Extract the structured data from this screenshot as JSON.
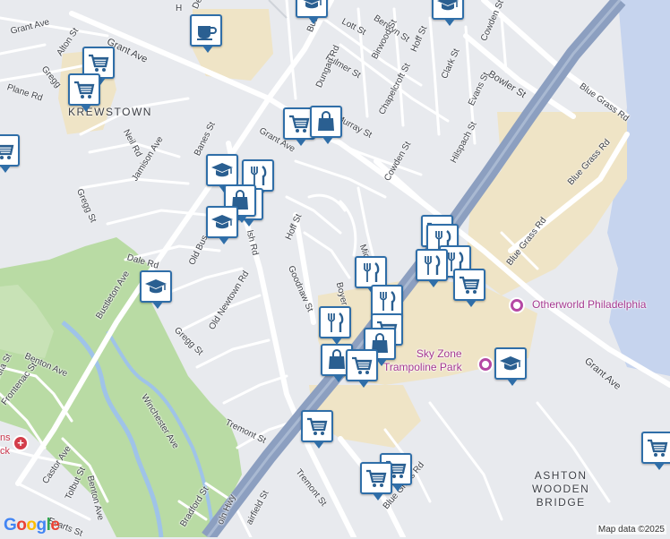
{
  "map": {
    "colors": {
      "background": "#e8eaee",
      "road": "#ffffff",
      "highway": "#8c9fc0",
      "park": "#b9dba4",
      "water": "#c6d4ee",
      "commercial": "#efe4c6",
      "river": "#9fc3e8",
      "pin_border": "#2f6ea8"
    },
    "area_labels": {
      "krewstown": "KREWSTOWN",
      "ashton_l1": "ASHTON",
      "ashton_l2": "WOODEN",
      "ashton_l3": "BRIDGE"
    },
    "streets": {
      "grant_ave_left": "Grant Ave",
      "grant_ave_mid": "Grant Ave",
      "grant_ave_right": "Grant Ave",
      "grant_ave_label_top": "Grant Ave",
      "alton_st": "Alton St",
      "gregg_st_top": "Gregg",
      "plane_rd": "Plane Rd",
      "neil_rd": "Neil Rd",
      "jamison_ave": "Jamison Ave",
      "banes_st": "Banes St",
      "gregg_st_left": "Gregg St",
      "dale_rd": "Dale Rd",
      "old_bustleton": "Old Bus",
      "welsh_rd": "lsh Rd",
      "hoff_st_mid": "Hoff St",
      "goodnaw_st": "Goodnaw St",
      "boyer_ave": "Boyer Ave",
      "michener_st": "Michener St",
      "bustleton_ave_top": "Bustleton",
      "bustleton_ave_left": "Bustleton Ave",
      "lott_st": "Lott St",
      "berwyn_st": "Berwyn St",
      "fulmer_st": "Fulmer St",
      "birwood_st": "Birwood St",
      "hoff_st_top": "Hoff St",
      "cowden_st_top": "Cowden St",
      "bowler_st": "Bowler St",
      "dungan_rd": "Dungan Rd",
      "chapelcroft_st": "Chapelcroft St",
      "clark_st": "Clark St",
      "murray_st": "Murray St",
      "evans_st": "Evans St",
      "blue_grass_rd_top": "Blue Grass Rd",
      "blue_grass_rd_r": "Blue Grass Rd",
      "blue_grass_rd_mid": "Blue Grass Rd",
      "blue_grass_rd_low": "Blue Grass Rd",
      "hilspach_st": "Hilspach St",
      "cowden_st_mid": "Cowden St",
      "gregg_st_mid": "Gregg St",
      "old_newtown_rd": "Old Newtown Rd",
      "winchester_ave": "Winchester Ave",
      "benton_ave_top": "Benton Ave",
      "frontenac_st": "Frontenac St",
      "benton_ave_low": "Benton Ave",
      "castor_ave": "Castor Ave",
      "tolbut_st": "Tolbut St",
      "evarts_st": "Evarts St",
      "tremont_st_top": "Tremont St",
      "tremont_st_low": "Tremont St",
      "bradford_st": "Bradford St",
      "fairfield_st": "airfield St",
      "roosevelt_hwy": "oln Hwy",
      "crest_st": "esta St",
      "dea_top": "De",
      "h_top": "H",
      "grant_ave_short": "Gra",
      "st_suffix": "St",
      "ave_frag": "ve"
    },
    "places": {
      "otherworld": "Otherworld Philadelphia",
      "skyzone_l1": "Sky Zone",
      "skyzone_l2": "Trampoline Park",
      "hospital_l1": "ns",
      "hospital_l2": "ck"
    },
    "markers": [
      {
        "icon": "shopping-cart-icon",
        "label": "grocery"
      },
      {
        "icon": "shopping-cart-icon",
        "label": "grocery"
      },
      {
        "icon": "shopping-cart-icon",
        "label": "grocery"
      },
      {
        "icon": "shopping-cart-icon",
        "label": "grocery"
      },
      {
        "icon": "shopping-bag-icon",
        "label": "shopping"
      },
      {
        "icon": "graduation-cap-icon",
        "label": "school"
      },
      {
        "icon": "coffee-cup-icon",
        "label": "cafe"
      },
      {
        "icon": "fork-knife-icon",
        "label": "restaurant"
      }
    ],
    "attribution": {
      "logo": "Google",
      "data": "Map data ©2025"
    }
  }
}
